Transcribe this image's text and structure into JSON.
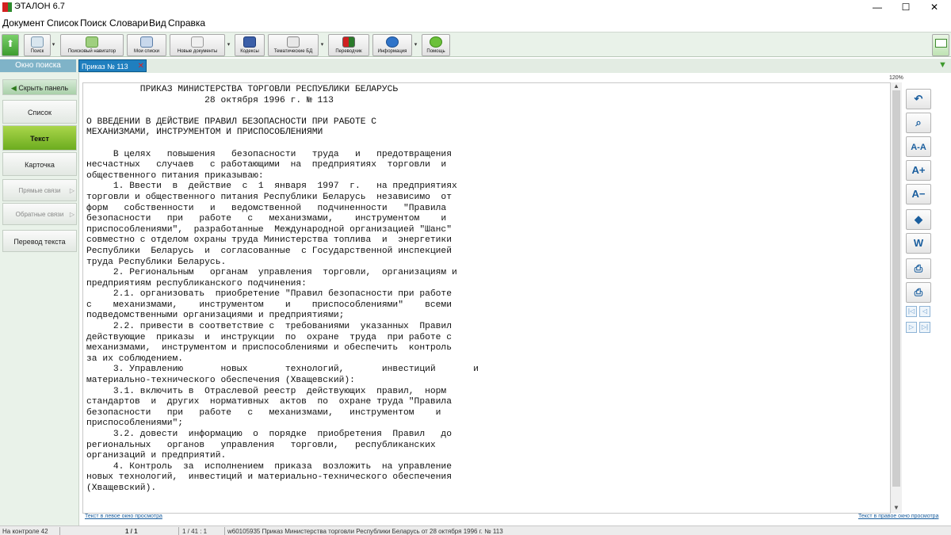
{
  "window": {
    "title": "ЭТАЛОН 6.7",
    "min": "—",
    "max": "☐",
    "close": "✕"
  },
  "menu": [
    "Документ",
    "Список",
    "Поиск",
    "Словари",
    "Вид",
    "Справка"
  ],
  "toolbar": [
    {
      "label": "",
      "icon": "up-arrow-icon"
    },
    {
      "label": "Поиск",
      "icon": "search-icon"
    },
    {
      "label": "Поисковый навигатор",
      "icon": "navigator-icon"
    },
    {
      "label": "Мои списки",
      "icon": "lists-icon"
    },
    {
      "label": "Новые документы",
      "icon": "new-docs-icon"
    },
    {
      "label": "Кодексы",
      "icon": "codex-icon"
    },
    {
      "label": "Тематические БД",
      "icon": "thematic-db-icon"
    },
    {
      "label": "Переводчик",
      "icon": "translator-icon"
    },
    {
      "label": "Информация",
      "icon": "info-icon"
    },
    {
      "label": "Помощь",
      "icon": "help-icon"
    }
  ],
  "tabs": {
    "search": "Окно поиска",
    "document": "Приказ № 113",
    "close": "✕"
  },
  "zoom": "120%",
  "left_panel": {
    "hide": "Скрыть панель",
    "list": "Список",
    "text": "Текст",
    "card": "Карточка",
    "direct": "Прямые связи",
    "reverse": "Обратные связи",
    "translate": "Перевод текста"
  },
  "document": {
    "lines": [
      "          ПРИКАЗ МИНИСТЕРСТВА ТОРГОВЛИ РЕСПУБЛИКИ БЕЛАРУСЬ",
      "                      28 октября 1996 г. № 113",
      "",
      "О ВВЕДЕНИИ В ДЕЙСТВИЕ ПРАВИЛ БЕЗОПАСНОСТИ ПРИ РАБОТЕ С",
      "МЕХАНИЗМАМИ, ИНСТРУМЕНТОМ И ПРИСПОСОБЛЕНИЯМИ",
      "",
      "     В целях   повышения   безопасности   труда   и   предотвращения",
      "несчастных   случаев   с работающими  на  предприятиях  торговли  и",
      "общественного питания приказываю:",
      "     1. Ввести  в  действие  с  1  января  1997  г.   на предприятиях",
      "торговли и общественного питания Республики Беларусь  независимо  от",
      "форм   собственности   и   ведомственной   подчиненности   \"Правила",
      "безопасности   при   работе   с   механизмами,    инструментом    и",
      "приспособлениями\",  разработанные  Международной организацией \"Шанс\"",
      "совместно с отделом охраны труда Министерства топлива  и  энергетики",
      "Республики  Беларусь  и  согласованные  с Государственной инспекцией",
      "труда Республики Беларусь.",
      "     2. Региональным   органам  управления  торговли,  организациям и",
      "предприятиям республиканского подчинения:",
      "     2.1. организовать  приобретение \"Правил безопасности при работе",
      "с    механизмами,    инструментом    и    приспособлениями\"    всеми",
      "подведомственными организациями и предприятиями;",
      "     2.2. привести в соответствие с  требованиями  указанных  Правил",
      "действующие  приказы  и  инструкции  по  охране  труда  при работе с",
      "механизмами,  инструментом и приспособлениями и обеспечить  контроль",
      "за их соблюдением.",
      "     3. Управлению       новых       технологий,       инвестиций       и",
      "материально-технического обеспечения (Хващевский):",
      "     3.1. включить в  Отраслевой реестр  действующих  правил,  норм",
      "стандартов  и  других  нормативных  актов  по  охране труда \"Правила",
      "безопасности   при   работе   с   механизмами,   инструментом    и",
      "приспособлениями\";",
      "     3.2. довести  информацию  о  порядке  приобретения  Правил   до",
      "региональных   органов   управления   торговли,   республиканских",
      "организаций и предприятий.",
      "     4. Контроль  за  исполнением  приказа  возложить  на управление",
      "новых технологий,  инвестиций и материально-технического обеспечения",
      "(Хващевский)."
    ]
  },
  "right_tools": [
    {
      "icon": "back-icon",
      "glyph": "↶"
    },
    {
      "icon": "magnifier-icon",
      "glyph": "⌕"
    },
    {
      "icon": "font-size-icon",
      "glyph": "A-A"
    },
    {
      "icon": "font-increase-icon",
      "glyph": "A+"
    },
    {
      "icon": "font-decrease-icon",
      "glyph": "A−"
    },
    {
      "icon": "eraser-icon",
      "glyph": "◆"
    },
    {
      "icon": "word-export-icon",
      "glyph": "W"
    },
    {
      "icon": "print-icon",
      "glyph": "⎙"
    },
    {
      "icon": "print-settings-icon",
      "glyph": "⎙"
    }
  ],
  "nav_buttons": [
    "|◁",
    "◁",
    "▷",
    "▷|"
  ],
  "links": {
    "left": "Текст в левое окно просмотра",
    "right": "Текст в правое окно просмотра"
  },
  "status": {
    "control": "На контроле 42",
    "page": "1 / 1",
    "position": "1 / 41 : 1",
    "doc": "w60105935  Приказ Министерства торговли Республики Беларусь от 28 октября 1996 г. № 113"
  }
}
